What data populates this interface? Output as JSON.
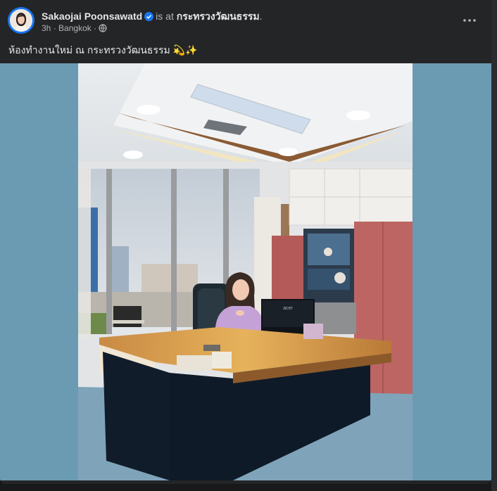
{
  "post": {
    "author": "Sakaojai Poonsawatd",
    "is_at": "is at",
    "place": "กระทรวงวัฒนธรรม",
    "period": ".",
    "time": "3h",
    "separator": "·",
    "location": "Bangkok",
    "separator2": "·",
    "caption": "ห้องทำงานใหม่ ณ กระทรวงวัฒนธรรม",
    "caption_emoji": "💫✨",
    "more_label": "···"
  },
  "photo": {
    "monitor_brand": "acer"
  },
  "colors": {
    "card_bg": "#242526",
    "photo_bg": "#6a9bb3",
    "verified": "#1877f2",
    "text_primary": "#e4e6eb",
    "text_secondary": "#b0b3b8"
  },
  "icons": {
    "verified": "verified-badge-icon",
    "audience": "globe-icon",
    "more": "more-dots-icon"
  }
}
